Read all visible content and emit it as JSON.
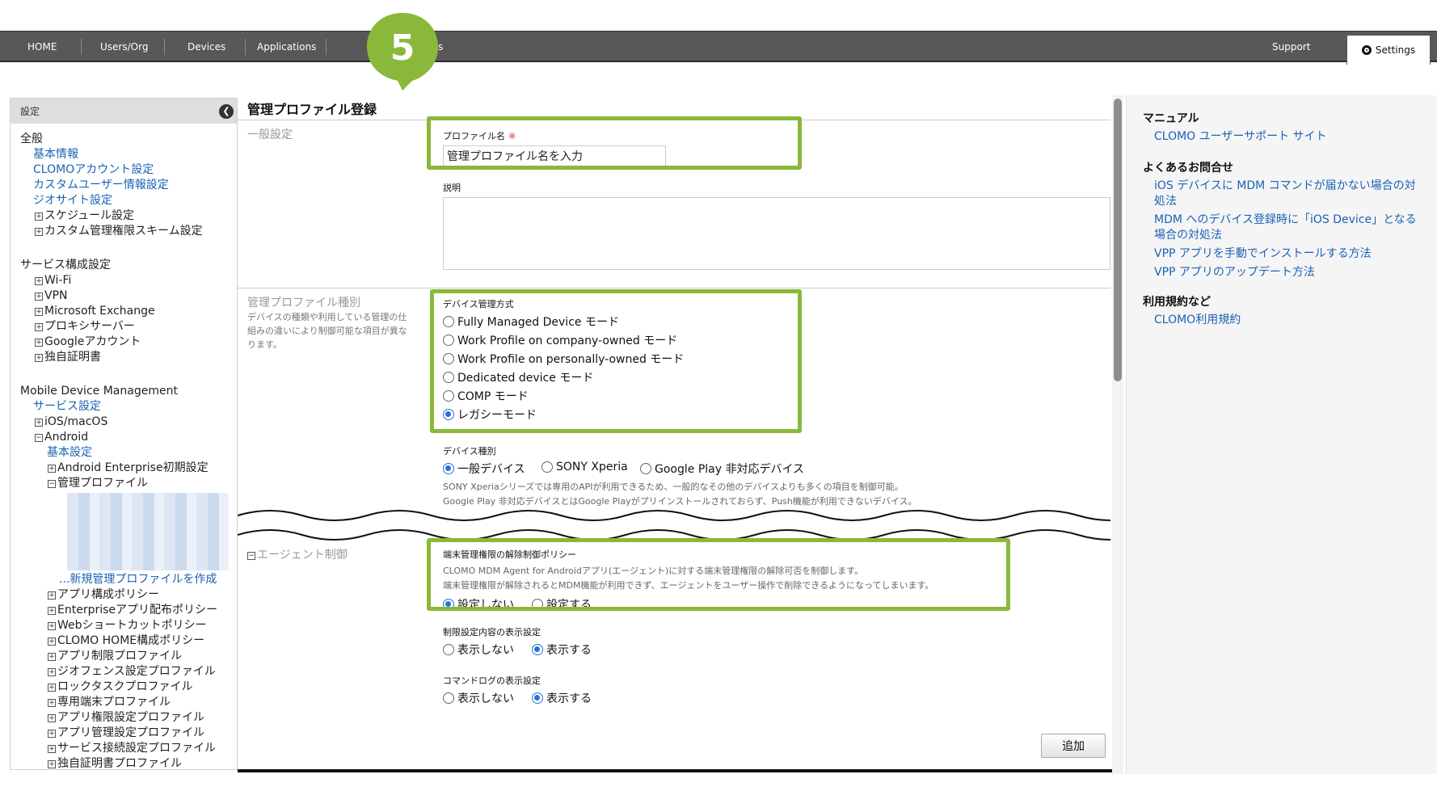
{
  "nav": {
    "home": "HOME",
    "users_org": "Users/Org",
    "devices": "Devices",
    "applications": "Applications",
    "reports_partial": "orts",
    "support": "Support",
    "settings": "Settings"
  },
  "step_badge": "5",
  "sidebar": {
    "header": "設定",
    "collapse_glyph": "❮",
    "group_all": "全般",
    "all_links": [
      "基本情報",
      "CLOMOアカウント設定",
      "カスタムユーザー情報設定",
      "ジオサイト設定"
    ],
    "all_nodes": [
      "スケジュール設定",
      "カスタム管理権限スキーム設定"
    ],
    "group_service": "サービス構成設定",
    "service_nodes": [
      "Wi-Fi",
      "VPN",
      "Microsoft Exchange",
      "プロキシサーバー",
      "Googleアカウント",
      "独自証明書"
    ],
    "group_mdm": "Mobile Device Management",
    "mdm_service": "サービス設定",
    "mdm_ios": "iOS/macOS",
    "mdm_android": "Android",
    "android_basic": "基本設定",
    "android_enterprise": "Android Enterprise初期設定",
    "managed_profile": "管理プロファイル",
    "new_profile": "...新規管理プロファイルを作成",
    "policy_nodes": [
      "アプリ構成ポリシー",
      "Enterpriseアプリ配布ポリシー",
      "Webショートカットポリシー",
      "CLOMO HOME構成ポリシー",
      "アプリ制限プロファイル",
      "ジオフェンス設定プロファイル",
      "ロックタスクプロファイル",
      "専用端末プロファイル",
      "アプリ権限設定プロファイル",
      "アプリ管理設定プロファイル",
      "サービス接続設定プロファイル",
      "独自証明書プロファイル"
    ]
  },
  "main": {
    "title": "管理プロファイル登録",
    "general_section": "一般設定",
    "profile_name_label": "プロファイル名",
    "required_mark": "※",
    "profile_name_value": "管理プロファイル名を入力",
    "description_label": "説明",
    "type_section": "管理プロファイル種別",
    "type_desc": "デバイスの種類や利用している管理の仕組みの違いにより制御可能な項目が異なります。",
    "mgmt_mode_label": "デバイス管理方式",
    "mgmt_modes": [
      "Fully Managed Device モード",
      "Work Profile on company-owned モード",
      "Work Profile on personally-owned モード",
      "Dedicated device モード",
      "COMP モード",
      "レガシーモード"
    ],
    "device_type_label": "デバイス種別",
    "device_types": [
      "一般デバイス",
      "SONY Xperia",
      "Google Play 非対応デバイス"
    ],
    "device_note_1": "SONY Xperiaシリーズでは専用のAPIが利用できるため、一般的なその他のデバイスよりも多くの項目を制御可能。",
    "device_note_2": "Google Play 非対応デバイスとはGoogle Playがプリインストールされておらず、Push機能が利用できないデバイス。",
    "agent_section": "エージェント制御",
    "agent_policy_label": "端末管理権限の解除制御ポリシー",
    "agent_note_1": "CLOMO MDM Agent for Androidアプリ(エージェント)に対する端末管理権限の解除可否を制御します。",
    "agent_note_2": "端末管理権限が解除されるとMDM機能が利用できず、エージェントをユーザー操作で削除できるようになってしまいます。",
    "agent_options": [
      "設定しない",
      "設定する"
    ],
    "restrict_label": "制限設定内容の表示設定",
    "restrict_options": [
      "表示しない",
      "表示する"
    ],
    "cmdlog_label": "コマンドログの表示設定",
    "cmdlog_options": [
      "表示しない",
      "表示する"
    ],
    "add_button": "追加"
  },
  "right": {
    "manual_heading": "マニュアル",
    "manual_links": [
      "CLOMO ユーザーサポート サイト"
    ],
    "faq_heading": "よくあるお問合せ",
    "faq_links": [
      "iOS デバイスに MDM コマンドが届かない場合の対処法",
      "MDM へのデバイス登録時に「iOS Device」となる場合の対処法",
      "VPP アプリを手動でインストールする方法",
      "VPP アプリのアップデート方法"
    ],
    "terms_heading": "利用規約など",
    "terms_links": [
      "CLOMO利用規約"
    ]
  },
  "colors": {
    "highlight": "#8ab83a",
    "link": "#1a62b5",
    "topbar": "#585858",
    "radio_on": "#2a6fdb"
  }
}
